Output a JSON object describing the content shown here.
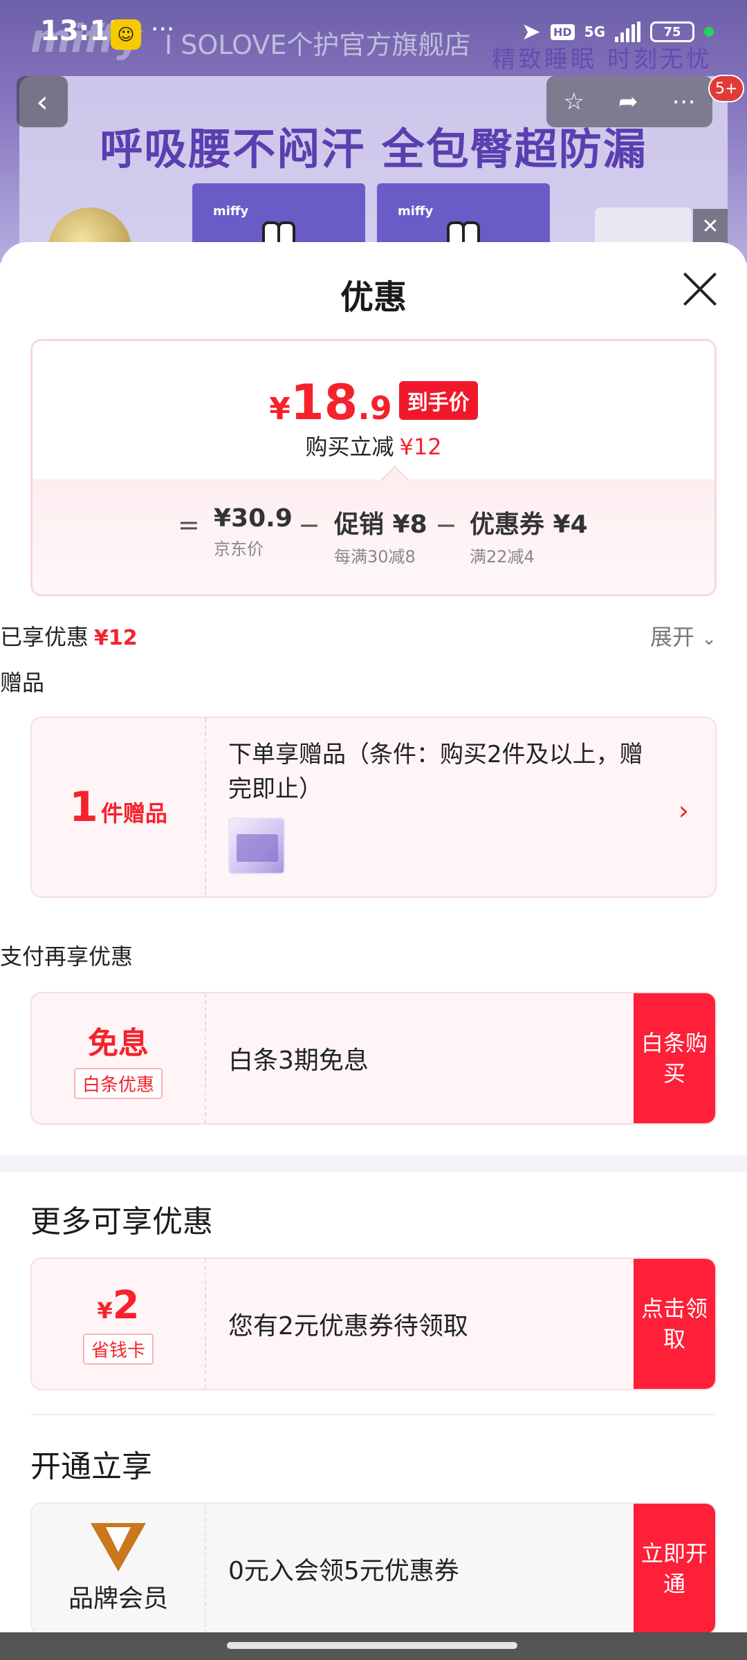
{
  "status_bar": {
    "time": "13:12",
    "app_badge_icon": "meituan-icon",
    "more_dots": "···",
    "hd": "HD",
    "network": "5G",
    "battery": "75"
  },
  "background_page": {
    "brand": "miffy",
    "store_name": "I SOLOVE个护官方旗舰店",
    "tagline": "精致睡眠 时刻无忧",
    "slogan": "呼吸腰不闷汗 全包臀超防漏",
    "pack_label": "miffy",
    "message_badge": "5+"
  },
  "sheet": {
    "title": "优惠",
    "price_card": {
      "currency": "¥",
      "final_int": "18",
      "final_dec": ".9",
      "final_badge": "到手价",
      "discount_label": "购买立减",
      "discount_amount": "¥12",
      "equals": "=",
      "minus": "−",
      "jd_price": "¥30.9",
      "jd_label": "京东价",
      "promo_main": "促销 ¥8",
      "promo_sub": "每满30减8",
      "coupon_main": "优惠券 ¥4",
      "coupon_sub": "满22减4"
    },
    "enjoyed": {
      "label": "已享优惠",
      "amount": "¥12",
      "expand": "展开"
    },
    "gifts": {
      "section_label": "赠品",
      "count": "1",
      "count_label": "件赠品",
      "description": "下单享赠品（条件：购买2件及以上，赠完即止）"
    },
    "payment": {
      "section_label": "支付再享优惠",
      "headline": "免息",
      "tag": "白条优惠",
      "text": "白条3期免息",
      "button": "白条购买"
    },
    "more": {
      "section_title": "更多可享优惠",
      "currency": "¥",
      "amount": "2",
      "tag": "省钱卡",
      "text": "您有2元优惠券待领取",
      "button": "点击领取"
    },
    "membership": {
      "section_title": "开通立享",
      "logo_label": "品牌会员",
      "text": "0元入会领5元优惠券",
      "button": "立即开通"
    }
  },
  "colors": {
    "accent_red": "#f5222d",
    "button_red": "#fe1f38",
    "card_bg": "#fff5f6"
  }
}
